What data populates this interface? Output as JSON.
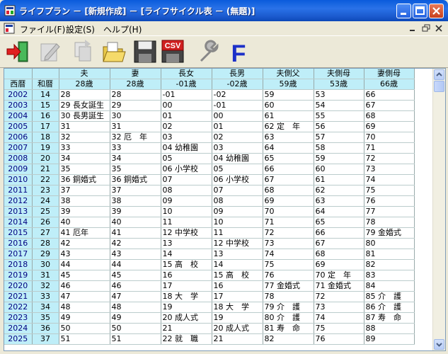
{
  "window": {
    "title": "ライフプラン － [新規作成] － [ライフサイクル表 － (無題)]"
  },
  "menu": [
    {
      "label": "ファイル(F)"
    },
    {
      "label": "設定(S)"
    },
    {
      "label": "ヘルプ(H)"
    }
  ],
  "toolbar": {
    "buttons": [
      "exit",
      "edit",
      "copy",
      "open",
      "save",
      "csv",
      "settings",
      "font"
    ],
    "csv_label": "CSV",
    "font_label": "F"
  },
  "table": {
    "col_headers": [
      "夫",
      "妻",
      "長女",
      "長男",
      "夫側父",
      "夫側母",
      "妻側母"
    ],
    "label_headers": [
      "西暦",
      "和暦"
    ],
    "ages": [
      "28歳",
      "28歳",
      "-01歳",
      "-02歳",
      "59歳",
      "53歳",
      "66歳"
    ],
    "rows": [
      [
        "2002",
        "14",
        "28",
        "28",
        "-01",
        "-02",
        "59",
        "53",
        "66"
      ],
      [
        "2003",
        "15",
        "29 長女誕生",
        "29",
        "00",
        "-01",
        "60",
        "54",
        "67"
      ],
      [
        "2004",
        "16",
        "30 長男誕生",
        "30",
        "01",
        "00",
        "61",
        "55",
        "68"
      ],
      [
        "2005",
        "17",
        "31",
        "31",
        "02",
        "01",
        "62 定　年",
        "56",
        "69"
      ],
      [
        "2006",
        "18",
        "32",
        "32 厄　年",
        "03",
        "02",
        "63",
        "57",
        "70"
      ],
      [
        "2007",
        "19",
        "33",
        "33",
        "04 幼稚園",
        "03",
        "64",
        "58",
        "71"
      ],
      [
        "2008",
        "20",
        "34",
        "34",
        "05",
        "04 幼稚園",
        "65",
        "59",
        "72"
      ],
      [
        "2009",
        "21",
        "35",
        "35",
        "06 小学校",
        "05",
        "66",
        "60",
        "73"
      ],
      [
        "2010",
        "22",
        "36 銅婚式",
        "36 銅婚式",
        "07",
        "06 小学校",
        "67",
        "61",
        "74"
      ],
      [
        "2011",
        "23",
        "37",
        "37",
        "08",
        "07",
        "68",
        "62",
        "75"
      ],
      [
        "2012",
        "24",
        "38",
        "38",
        "09",
        "08",
        "69",
        "63",
        "76"
      ],
      [
        "2013",
        "25",
        "39",
        "39",
        "10",
        "09",
        "70",
        "64",
        "77"
      ],
      [
        "2014",
        "26",
        "40",
        "40",
        "11",
        "10",
        "71",
        "65",
        "78"
      ],
      [
        "2015",
        "27",
        "41 厄年",
        "41",
        "12 中学校",
        "11",
        "72",
        "66",
        "79 金婚式"
      ],
      [
        "2016",
        "28",
        "42",
        "42",
        "13",
        "12 中学校",
        "73",
        "67",
        "80"
      ],
      [
        "2017",
        "29",
        "43",
        "43",
        "14",
        "13",
        "74",
        "68",
        "81"
      ],
      [
        "2018",
        "30",
        "44",
        "44",
        "15 高　校",
        "14",
        "75",
        "69",
        "82"
      ],
      [
        "2019",
        "31",
        "45",
        "45",
        "16",
        "15 高　校",
        "76",
        "70 定　年",
        "83"
      ],
      [
        "2020",
        "32",
        "46",
        "46",
        "17",
        "16",
        "77 金婚式",
        "71 金婚式",
        "84"
      ],
      [
        "2021",
        "33",
        "47",
        "47",
        "18 大　学",
        "17",
        "78",
        "72",
        "85 介　護"
      ],
      [
        "2022",
        "34",
        "48",
        "48",
        "19",
        "18 大　学",
        "79 介　護",
        "73",
        "86 介　護"
      ],
      [
        "2023",
        "35",
        "49",
        "49",
        "20 成人式",
        "19",
        "80 介　護",
        "74",
        "87 寿　命"
      ],
      [
        "2024",
        "36",
        "50",
        "50",
        "21",
        "20 成人式",
        "81 寿　命",
        "75",
        "88"
      ],
      [
        "2025",
        "37",
        "51",
        "51",
        "22 就　職",
        "21",
        "82",
        "76",
        "89"
      ]
    ]
  }
}
